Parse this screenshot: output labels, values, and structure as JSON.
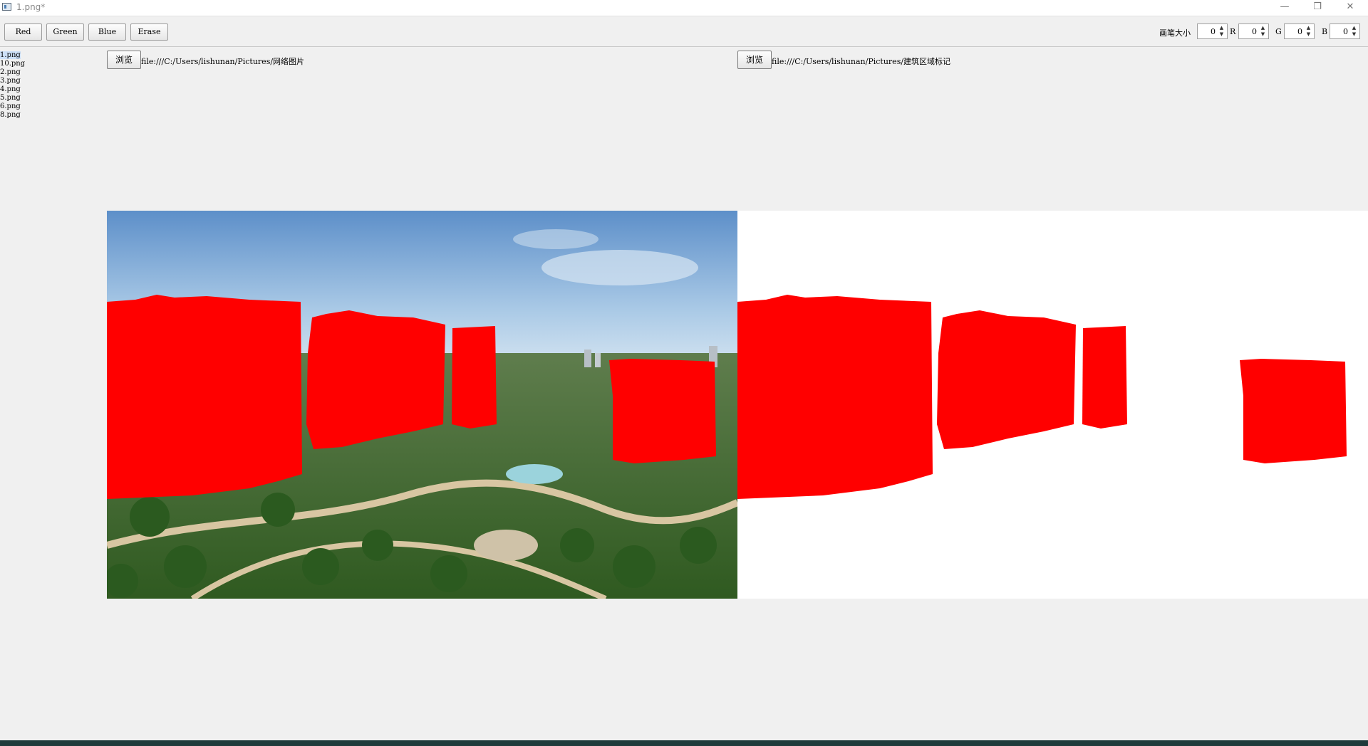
{
  "window": {
    "title": "1.png*",
    "minimize_glyph": "—",
    "restore_glyph": "❐",
    "close_glyph": "✕"
  },
  "toolbar": {
    "buttons": [
      "Red",
      "Green",
      "Blue",
      "Erase"
    ],
    "brush_size_label": "画笔大小",
    "brush_size_value": "0",
    "r_label": "R",
    "r_value": "0",
    "g_label": "G",
    "g_value": "0",
    "b_label": "B",
    "b_value": "0"
  },
  "file_list": [
    "1.png",
    "10.png",
    "2.png",
    "3.png",
    "4.png",
    "5.png",
    "6.png",
    "8.png"
  ],
  "left_panel": {
    "browse_label": "浏览",
    "path": "file:///C:/Users/lishunan/Pictures/网络图片"
  },
  "right_panel": {
    "browse_label": "浏览",
    "path": "file:///C:/Users/lishunan/Pictures/建筑区域标记"
  },
  "colors": {
    "mask": "#ff0000",
    "sky": "#6f9fd0",
    "vegetation": "#3c6a2a",
    "selection": "#cde0f7"
  }
}
